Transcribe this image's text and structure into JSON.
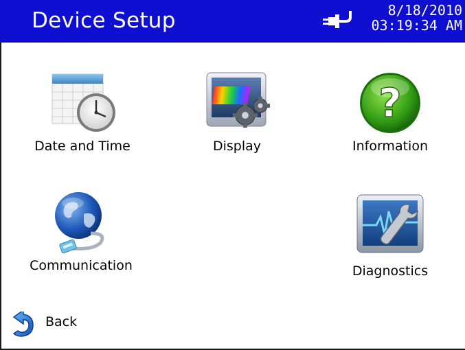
{
  "header": {
    "title": "Device Setup",
    "date": "8/18/2010",
    "time": "03:19:34 AM",
    "status_icon": "power-plug-icon",
    "background_color": "#0f0fd2"
  },
  "tiles": [
    {
      "label": "Date and Time",
      "icon": "calendar-clock-icon"
    },
    {
      "label": "Display",
      "icon": "display-settings-icon"
    },
    {
      "label": "Information",
      "icon": "help-question-icon"
    },
    {
      "label": "Communication",
      "icon": "network-globe-icon"
    },
    {
      "label": "Diagnostics",
      "icon": "diagnostics-monitor-icon"
    }
  ],
  "back": {
    "label": "Back",
    "icon": "back-arrow-icon"
  }
}
